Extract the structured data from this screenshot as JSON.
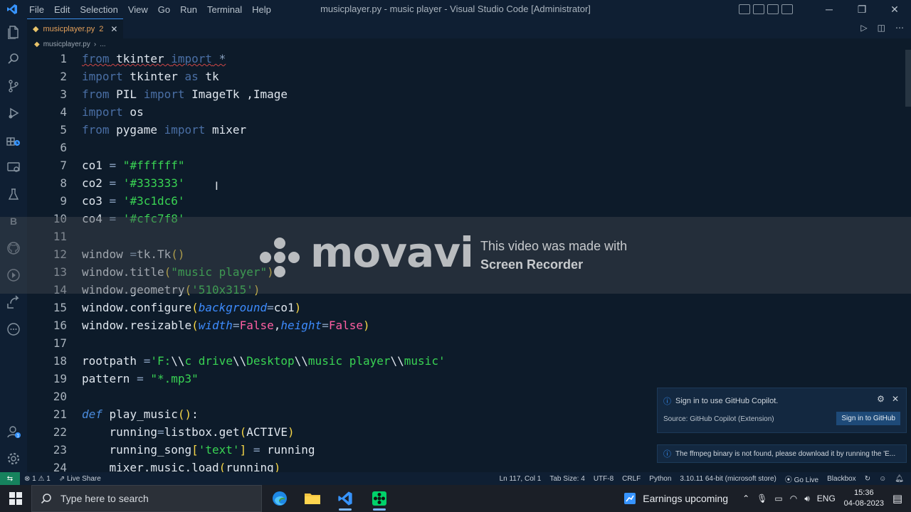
{
  "titlebar": {
    "menu": [
      "File",
      "Edit",
      "Selection",
      "View",
      "Go",
      "Run",
      "Terminal",
      "Help"
    ],
    "window_title": "musicplayer.py - music player - Visual Studio Code [Administrator]"
  },
  "tab": {
    "filename": "musicplayer.py",
    "problems": "2"
  },
  "breadcrumb": {
    "file": "musicplayer.py",
    "more": "..."
  },
  "code_lines": [
    {
      "n": "1",
      "text": "from tkinter import *"
    },
    {
      "n": "2",
      "text": "import tkinter as tk"
    },
    {
      "n": "3",
      "text": "from PIL import ImageTk ,Image"
    },
    {
      "n": "4",
      "text": "import os"
    },
    {
      "n": "5",
      "text": "from pygame import mixer"
    },
    {
      "n": "6",
      "text": ""
    },
    {
      "n": "7",
      "text": "co1 = \"#ffffff\""
    },
    {
      "n": "8",
      "text": "co2 = '#333333'"
    },
    {
      "n": "9",
      "text": "co3 = '#3c1dc6'"
    },
    {
      "n": "10",
      "text": "co4 = '#cfc7f8'"
    },
    {
      "n": "11",
      "text": ""
    },
    {
      "n": "12",
      "text": "window =tk.Tk()"
    },
    {
      "n": "13",
      "text": "window.title(\"music player\")"
    },
    {
      "n": "14",
      "text": "window.geometry('510x315')"
    },
    {
      "n": "15",
      "text": "window.configure(background=co1)"
    },
    {
      "n": "16",
      "text": "window.resizable(width=False,height=False)"
    },
    {
      "n": "17",
      "text": ""
    },
    {
      "n": "18",
      "text": "rootpath ='F:\\\\c drive\\\\Desktop\\\\music player\\\\music'"
    },
    {
      "n": "19",
      "text": "pattern = \"*.mp3\""
    },
    {
      "n": "20",
      "text": ""
    },
    {
      "n": "21",
      "text": "def play_music():"
    },
    {
      "n": "22",
      "text": "    running=listbox.get(ACTIVE)"
    },
    {
      "n": "23",
      "text": "    running_song['text'] = running"
    },
    {
      "n": "24",
      "text": "    mixer.music.load(running)"
    }
  ],
  "watermark": {
    "brand": "movavi",
    "line1": "This video was made with",
    "line2": "Screen Recorder"
  },
  "notifications": {
    "copilot": {
      "message": "Sign in to use GitHub Copilot.",
      "source": "Source: GitHub Copilot (Extension)",
      "button": "Sign in to GitHub"
    },
    "ffmpeg": {
      "message": "The ffmpeg binary is not found, please download it by running the 'E..."
    }
  },
  "statusbar": {
    "errors": "1",
    "warnings": "1",
    "live_share": "Live Share",
    "position": "Ln 117, Col 1",
    "tab_size": "Tab Size: 4",
    "encoding": "UTF-8",
    "eol": "CRLF",
    "language": "Python",
    "interpreter": "3.10.11 64-bit (microsoft store)",
    "go_live": "Go Live",
    "blackbox": "Blackbox"
  },
  "taskbar": {
    "search_placeholder": "Type here to search",
    "weather": "Earnings upcoming",
    "lang": "ENG",
    "time": "15:36",
    "date": "04-08-2023"
  },
  "colors": {
    "editor_bg": "#0d1b2a",
    "string": "#39d353",
    "keyword": "#4a6fa5",
    "param": "#3d8bfd",
    "bool": "#ff5fa2",
    "accent": "#3794ff"
  }
}
